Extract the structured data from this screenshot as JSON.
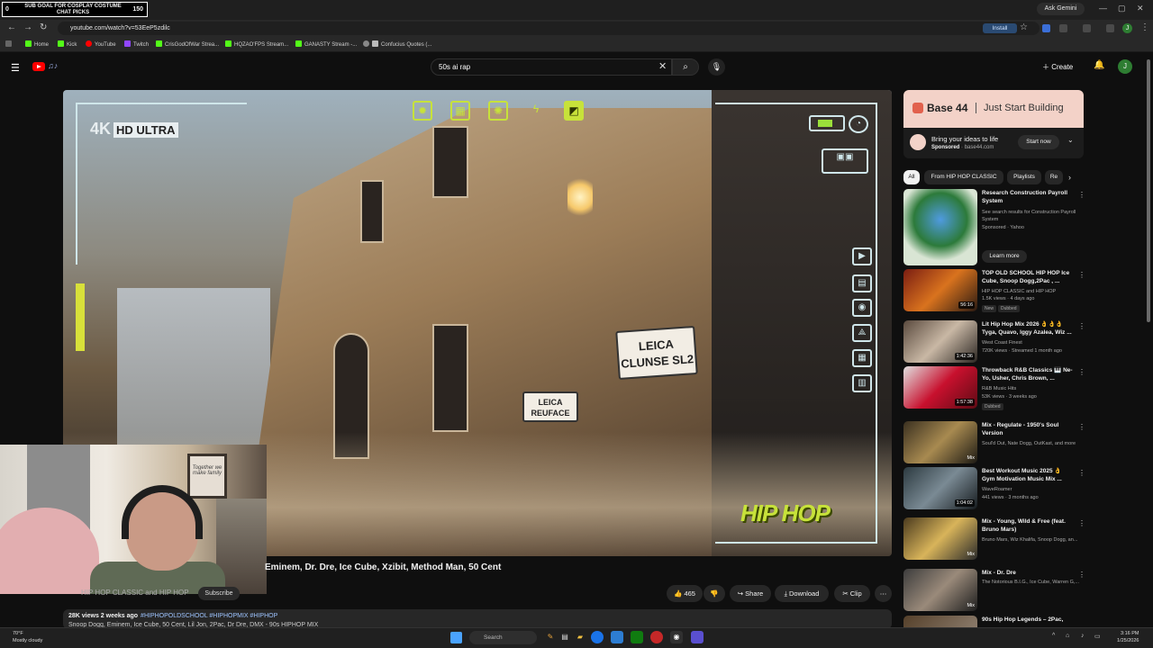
{
  "stream_overlay": {
    "goal_text": "SUB GOAL FOR COSPLAY COSTUME CHAT PICKS",
    "goal_start": "0",
    "goal_target": "150"
  },
  "browser": {
    "ask_gemini": "Ask Gemini",
    "url": "youtube.com/watch?v=53EeP5zdilc",
    "install_label": "Install",
    "profile_initial": "J",
    "bookmarks": [
      "Home",
      "Kick",
      "YouTube",
      "Twitch",
      "CrisGodOfWar Strea...",
      "HQZAO'FPS Stream...",
      "GANASTY Stream -...",
      "Confucius Quotes (..."
    ]
  },
  "youtube_header": {
    "search_query": "50s ai rap",
    "create_label": "Create",
    "avatar_initial": "J"
  },
  "player": {
    "hd_label": "4K",
    "hd_badge": "HD ULTRA",
    "sign_main": "LEICA CLUNSE SL2",
    "sign_small": "LEICA REUFACE",
    "brand_logo": "HIP HOP"
  },
  "webcam": {
    "frame_text": "Together we make family"
  },
  "video": {
    "title_visible": "Eminem, Dr. Dre, Ice Cube, Xzibit, Method Man, 50 Cent",
    "channel": "HIP HOP CLASSIC and HIP HOP",
    "subscribe": "Subscribe",
    "likes": "465",
    "share": "Share",
    "download": "Download",
    "clip": "Clip",
    "views_date": "28K views  2 weeks ago",
    "tags": "#HIPHOPOLDSCHOOL #HIPHOPMIX #HIPHOP",
    "desc_snippet": "Snoop Dogg, Eminem, Ice Cube, 50 Cent, Lil Jon, 2Pac, Dr Dre, DMX - 90s HIPHOP MIX"
  },
  "ad": {
    "brand": "Base 44",
    "tagline": "Just Start Building",
    "headline": "Bring your ideas to life",
    "sponsored": "Sponsored",
    "domain": "base44.com",
    "cta": "Start now"
  },
  "chips": [
    "All",
    "From HIP HOP CLASSIC",
    "Playlists",
    "Re"
  ],
  "recommendations": [
    {
      "title": "Research Construction Payroll System",
      "line1": "See search results for Construction Payroll System",
      "line2": "Sponsored · Yahoo",
      "cta": "Learn more"
    },
    {
      "title": "TOP OLD SCHOOL HIP HOP Ice Cube, Snoop Dogg,2Pac , ...",
      "channel": "HIP HOP CLASSIC and HIP HOP",
      "meta": "1.5K views · 4 days ago",
      "badges": [
        "New",
        "Dubbed"
      ],
      "duration": "56:16"
    },
    {
      "title": "Lit Hip Hop Mix 2026 👌👌👌 Tyga, Quavo, Iggy Azalea, Wiz ...",
      "channel": "West Coast Finest",
      "meta": "720K views · Streamed 1 month ago",
      "duration": "1:42:36"
    },
    {
      "title": "Throwback R&B Classics 🎹 Ne-Yo, Usher, Chris Brown, ...",
      "channel": "R&B Music Hits",
      "meta": "53K views · 3 weeks ago",
      "badges": [
        "Dubbed"
      ],
      "duration": "1:57:38"
    },
    {
      "title": "Mix - Regulate - 1950's Soul Version",
      "channel": "Soul'd Out, Nate Dogg, OutKast, and more",
      "duration": "Mix"
    },
    {
      "title": "Best Workout Music 2025 👌 Gym Motivation Music Mix ...",
      "channel": "WaveRoamer",
      "meta": "441 views · 3 months ago",
      "duration": "1:04:02"
    },
    {
      "title": "Mix - Young, Wild & Free (feat. Bruno Mars)",
      "channel": "Bruno Mars, Wiz Khalifa, Snoop Dogg, an...",
      "duration": "Mix"
    },
    {
      "title": "Mix - Dr. Dre",
      "channel": "The Notorious B.I.G., Ice Cube, Warren G,...",
      "duration": "Mix"
    },
    {
      "title": "90s Hip Hop Legends – 2Pac,"
    }
  ],
  "taskbar": {
    "weather_temp": "70°F",
    "weather_desc": "Mostly cloudy",
    "search_placeholder": "Search",
    "time": "3:16 PM",
    "date": "1/25/2026"
  },
  "colors": {
    "youtube_red": "#ff0000",
    "accent_green": "#c7e23a",
    "background": "#0f0f0f"
  }
}
